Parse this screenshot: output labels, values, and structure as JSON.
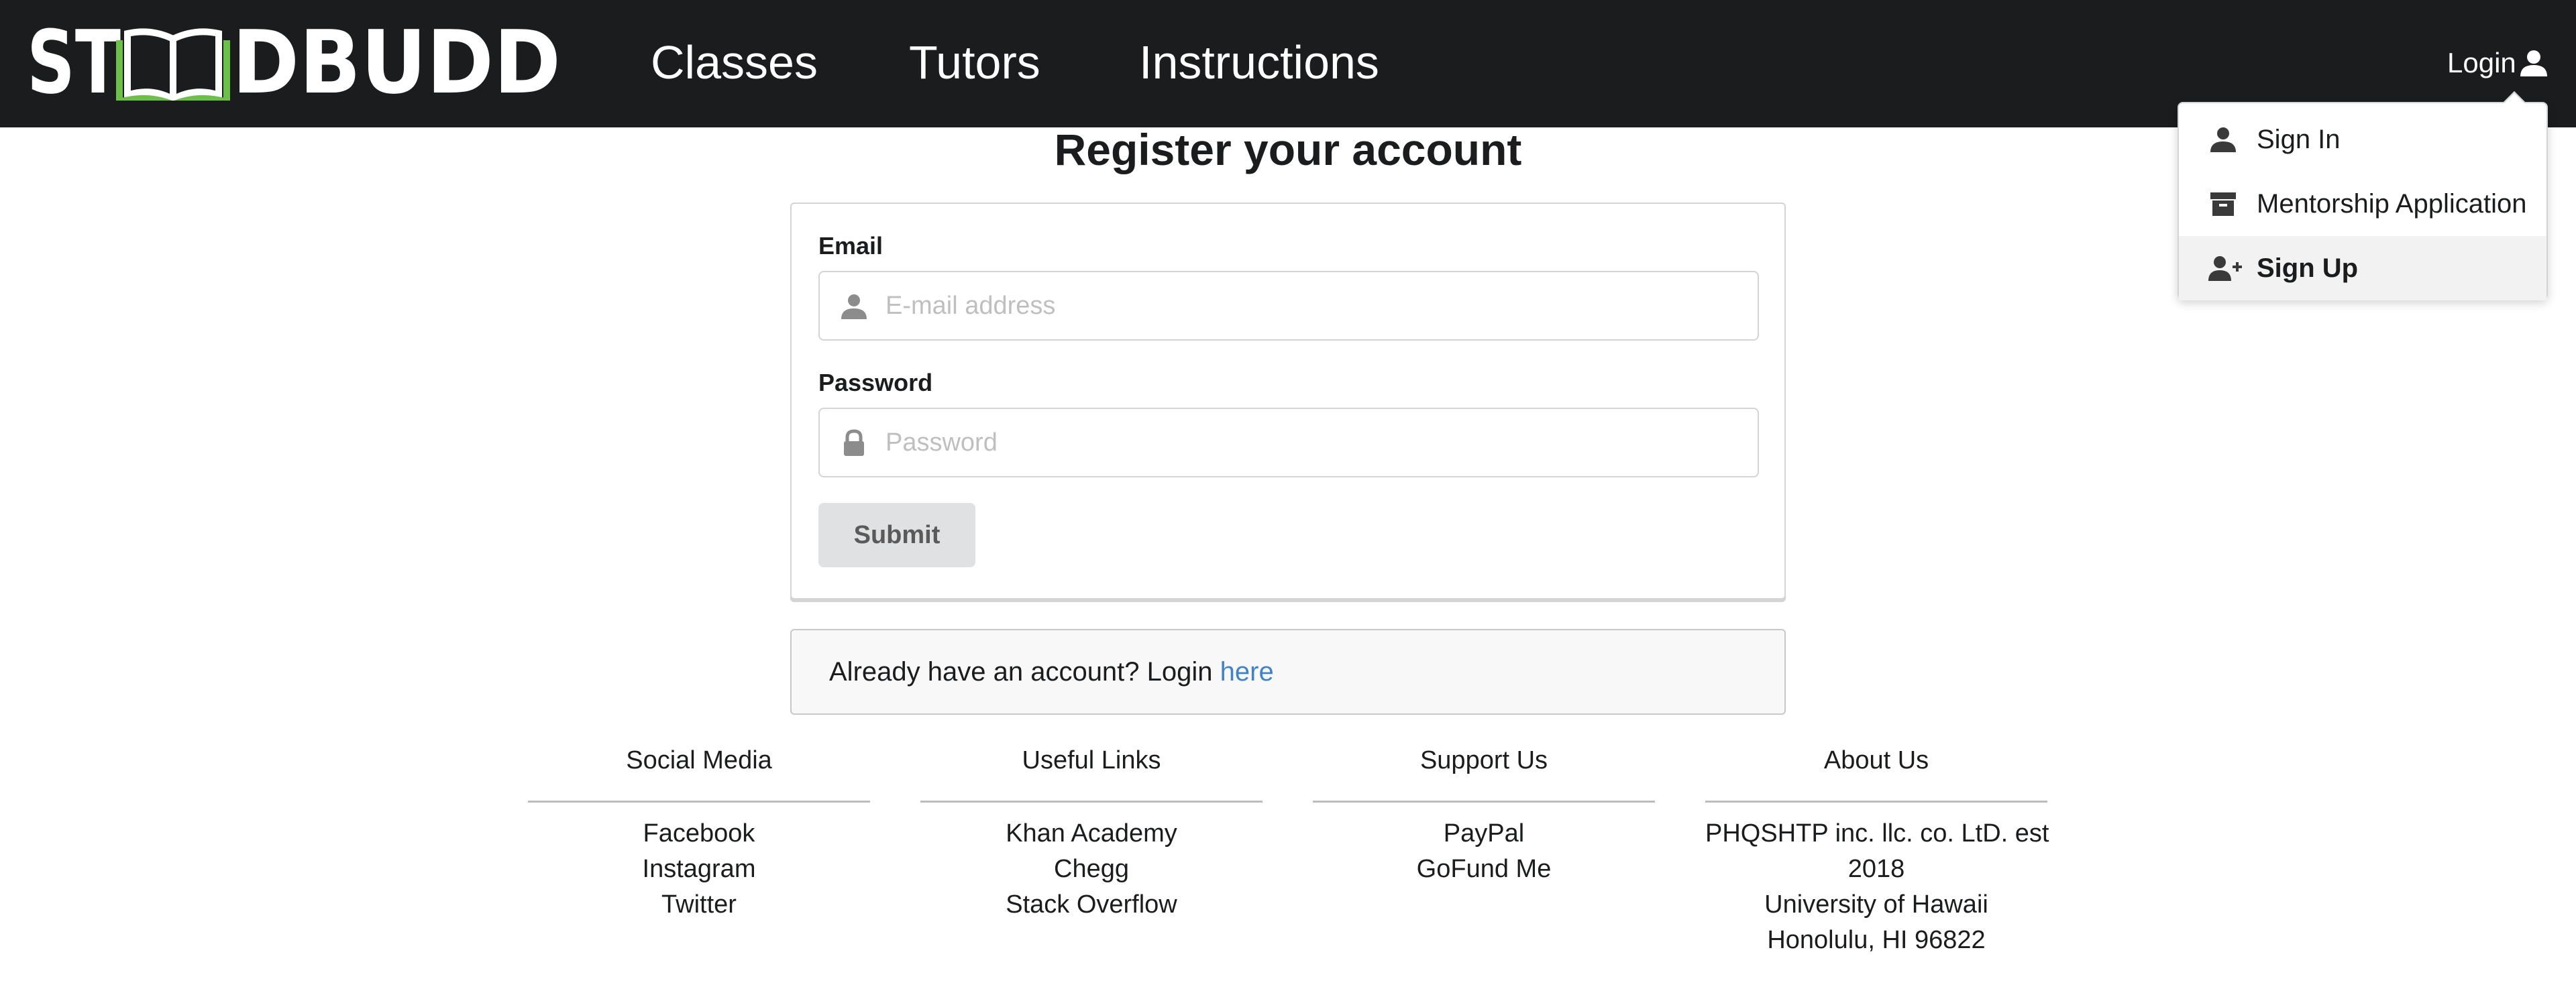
{
  "brand": {
    "logo_text": "STUDBUDD"
  },
  "nav": {
    "links": [
      {
        "label": "Classes"
      },
      {
        "label": "Tutors"
      },
      {
        "label": "Instructions"
      }
    ],
    "login_label": "Login"
  },
  "dropdown": {
    "items": [
      {
        "label": "Sign In",
        "icon": "user-icon"
      },
      {
        "label": "Mentorship Application",
        "icon": "archive-icon"
      },
      {
        "label": "Sign Up",
        "icon": "add-user-icon",
        "active": true
      }
    ]
  },
  "form": {
    "title": "Register your account",
    "email_label": "Email",
    "email_placeholder": "E-mail address",
    "email_value": "",
    "password_label": "Password",
    "password_placeholder": "Password",
    "password_value": "",
    "submit_label": "Submit"
  },
  "message": {
    "text": "Already have an account? Login ",
    "link": "here"
  },
  "footer": {
    "columns": [
      {
        "heading": "Social Media",
        "items": [
          "Facebook",
          "Instagram",
          "Twitter"
        ]
      },
      {
        "heading": "Useful Links",
        "items": [
          "Khan Academy",
          "Chegg",
          "Stack Overflow"
        ]
      },
      {
        "heading": "Support Us",
        "items": [
          "PayPal",
          "GoFund Me"
        ]
      },
      {
        "heading": "About Us",
        "items": [
          "PHQSHTP inc. llc. co. LtD. est",
          "2018",
          "University of Hawaii",
          "Honolulu, HI 96822"
        ]
      }
    ]
  },
  "colors": {
    "navbar_bg": "#1b1c1d",
    "logo_accent": "#6cc04a",
    "link": "#4183c4",
    "button_bg": "#e0e1e2"
  }
}
